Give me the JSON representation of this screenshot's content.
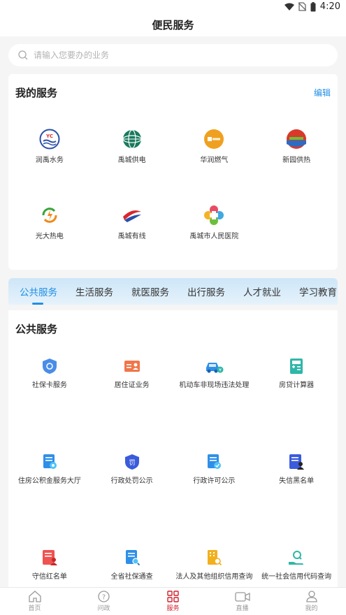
{
  "status": {
    "time": "4:20"
  },
  "header": {
    "title": "便民服务"
  },
  "search": {
    "placeholder": "请输入您要办的业务"
  },
  "my_services": {
    "title": "我的服务",
    "edit_label": "编辑",
    "items": [
      {
        "label": "润禹水务",
        "icon": "water-logo-icon",
        "color": "#2b4fa8"
      },
      {
        "label": "禹城供电",
        "icon": "power-grid-logo-icon",
        "color": "#1a7a5e"
      },
      {
        "label": "华润燃气",
        "icon": "gas-logo-icon",
        "color": "#f0a020"
      },
      {
        "label": "新园供热",
        "icon": "heating-logo-icon",
        "color": "#d8392b"
      },
      {
        "label": "光大热电",
        "icon": "thermal-power-logo-icon",
        "color": "#3aa43a"
      },
      {
        "label": "禹城有线",
        "icon": "cable-tv-logo-icon",
        "color": "#d8272d"
      },
      {
        "label": "禹城市人民医院",
        "icon": "hospital-logo-icon",
        "color": "#e94b63"
      }
    ]
  },
  "tabs": {
    "items": [
      "公共服务",
      "生活服务",
      "就医服务",
      "出行服务",
      "人才就业",
      "学习教育"
    ],
    "active_index": 0
  },
  "public_services": {
    "title": "公共服务",
    "items": [
      {
        "label": "社保卡服务",
        "icon": "shield-card-icon",
        "color": "#4a8de8"
      },
      {
        "label": "居住证业务",
        "icon": "id-card-icon",
        "color": "#f0764a"
      },
      {
        "label": "机动车非现场违法处理",
        "icon": "car-icon",
        "color": "#2f8fe8"
      },
      {
        "label": "房贷计算器",
        "icon": "calculator-icon",
        "color": "#2fb7a8"
      },
      {
        "label": "住房公积金服务大厅",
        "icon": "document-badge-icon",
        "color": "#2f8fe8"
      },
      {
        "label": "行政处罚公示",
        "icon": "penalty-shield-icon",
        "color": "#3b5bdb"
      },
      {
        "label": "行政许可公示",
        "icon": "license-document-icon",
        "color": "#2f8fe8"
      },
      {
        "label": "失信黑名单",
        "icon": "blacklist-user-icon",
        "color": "#3b5bdb"
      },
      {
        "label": "守信红名单",
        "icon": "redlist-user-icon",
        "color": "#ef5350"
      },
      {
        "label": "全省社保通查",
        "icon": "search-document-icon",
        "color": "#2f8fe8"
      },
      {
        "label": "法人及其他组织信用查询",
        "icon": "org-search-icon",
        "color": "#f2b01e"
      },
      {
        "label": "统一社会信用代码查询",
        "icon": "hand-search-icon",
        "color": "#2fb7a8"
      }
    ]
  },
  "bottom_nav": {
    "items": [
      {
        "label": "首页",
        "icon": "home-icon"
      },
      {
        "label": "问政",
        "icon": "question-icon"
      },
      {
        "label": "服务",
        "icon": "grid-icon"
      },
      {
        "label": "直播",
        "icon": "video-icon"
      },
      {
        "label": "我的",
        "icon": "user-icon"
      }
    ],
    "active_index": 2,
    "active_color": "#d11f2a"
  }
}
